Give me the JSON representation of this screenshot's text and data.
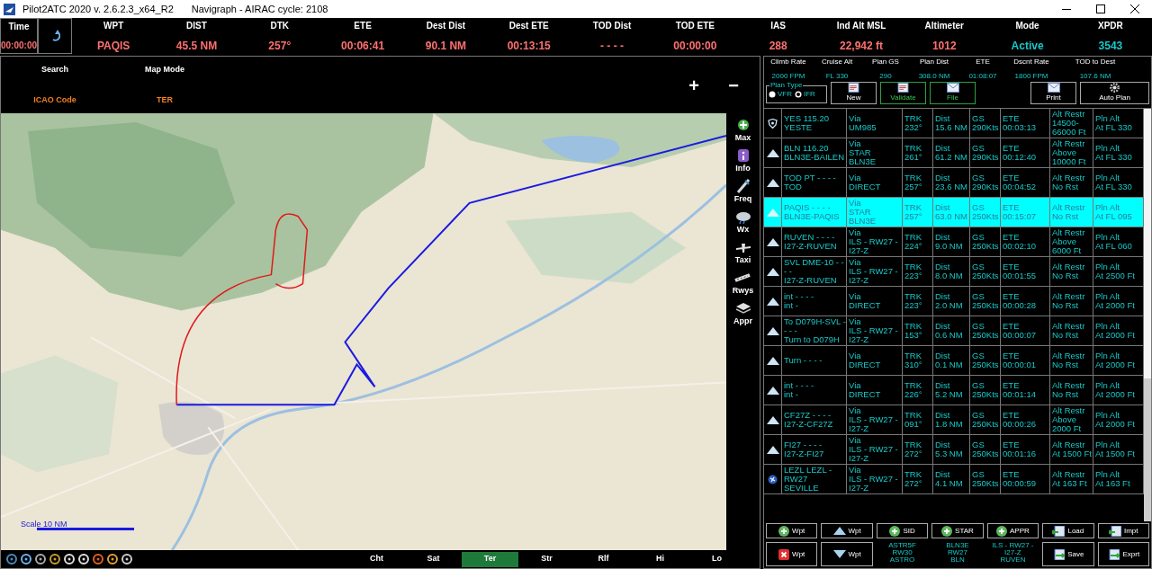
{
  "window": {
    "title": "Pilot2ATC 2020 v. 2.6.2.3_x64_R2",
    "subtitle": "Navigraph - AIRAC cycle: 2108"
  },
  "time": {
    "label": "Time",
    "value": "00:00:00"
  },
  "readouts": [
    {
      "label": "WPT",
      "value": "PAQIS",
      "color": "#ff7070"
    },
    {
      "label": "DIST",
      "value": "45.5 NM",
      "color": "#ff7070"
    },
    {
      "label": "DTK",
      "value": "257°",
      "color": "#ff7070"
    },
    {
      "label": "ETE",
      "value": "00:06:41",
      "color": "#ff7070"
    },
    {
      "label": "Dest Dist",
      "value": "90.1 NM",
      "color": "#ff7070"
    },
    {
      "label": "Dest ETE",
      "value": "00:13:15",
      "color": "#ff7070"
    },
    {
      "label": "TOD Dist",
      "value": "- - - -",
      "color": "#ff7070"
    },
    {
      "label": "TOD ETE",
      "value": "00:00:00",
      "color": "#ff7070"
    },
    {
      "label": "IAS",
      "value": "288",
      "color": "#ff7070"
    },
    {
      "label": "Ind Alt MSL",
      "value": "22,942 ft",
      "color": "#ff7070"
    },
    {
      "label": "Altimeter",
      "value": "1012",
      "color": "#ff7070"
    },
    {
      "label": "Mode",
      "value": "Active",
      "color": "#19c8c8"
    },
    {
      "label": "XPDR",
      "value": "3543",
      "color": "#19c8c8"
    }
  ],
  "map_panel": {
    "search": {
      "label": "Search",
      "value": "ICAO Code"
    },
    "map_mode": {
      "label": "Map Mode",
      "value": "TER"
    },
    "zoom_buttons": [
      "+",
      "−"
    ],
    "side_tools": [
      "Max",
      "Info",
      "Freq",
      "Wx",
      "Taxi",
      "Rwys",
      "Appr"
    ],
    "scale": "Scale 10 NM",
    "map_tabs": [
      {
        "label": "Cht",
        "selected": false
      },
      {
        "label": "Sat",
        "selected": false
      },
      {
        "label": "Ter",
        "selected": true
      },
      {
        "label": "Str",
        "selected": false
      },
      {
        "label": "Rlf",
        "selected": false
      },
      {
        "label": "Hi",
        "selected": false
      },
      {
        "label": "Lo",
        "selected": false
      }
    ]
  },
  "plan": {
    "stats": [
      {
        "label": "Climb Rate",
        "value": "2000 FPM"
      },
      {
        "label": "Cruise Alt",
        "value": "FL 330"
      },
      {
        "label": "Plan GS",
        "value": "290"
      },
      {
        "label": "Plan Dist",
        "value": "308.0 NM"
      },
      {
        "label": "ETE",
        "value": "01:08:07"
      },
      {
        "label": "Dscnt Rate",
        "value": "1800 FPM"
      },
      {
        "label": "TOD to Dest",
        "value": "107.6 NM"
      }
    ],
    "plan_type": {
      "label": "Plan Type",
      "options": [
        {
          "label": "VFR",
          "selected": false
        },
        {
          "label": "IFR",
          "selected": true
        }
      ]
    },
    "buttons_left": [
      {
        "label": "New",
        "highlighted": false
      },
      {
        "label": "Validate",
        "highlighted": true
      },
      {
        "label": "File",
        "highlighted": true
      }
    ],
    "buttons_right": [
      {
        "label": "Print",
        "highlighted": false
      },
      {
        "label": "Auto Plan",
        "highlighted": false
      }
    ]
  },
  "route_table": [
    {
      "kind": "vor",
      "selected": false,
      "name": [
        "YES   115.20",
        "YESTE"
      ],
      "via": [
        "Via",
        "UM985"
      ],
      "trk": [
        "TRK",
        "232°"
      ],
      "dist": [
        "Dist",
        "15.6 NM"
      ],
      "gs": [
        "GS",
        "290Kts"
      ],
      "ete": [
        "ETE",
        "00:03:13"
      ],
      "alt_restr": [
        "Alt Restr",
        "14500-",
        "66000 Ft"
      ],
      "pln_alt": [
        "Pln Alt",
        "At FL 330"
      ]
    },
    {
      "kind": "waypoint",
      "selected": false,
      "name": [
        "BLN   116.20",
        "BLN3E-BAILEN"
      ],
      "via": [
        "Via",
        "STAR",
        "BLN3E"
      ],
      "trk": [
        "TRK",
        "261°"
      ],
      "dist": [
        "Dist",
        "61.2 NM"
      ],
      "gs": [
        "GS",
        "290Kts"
      ],
      "ete": [
        "ETE",
        "00:12:40"
      ],
      "alt_restr": [
        "Alt Restr",
        "Above",
        "10000 Ft"
      ],
      "pln_alt": [
        "Pln Alt",
        "At FL 330"
      ]
    },
    {
      "kind": "waypoint",
      "selected": false,
      "name": [
        "TOD PT   - - - -",
        "TOD"
      ],
      "via": [
        "Via",
        "DIRECT"
      ],
      "trk": [
        "TRK",
        "257°"
      ],
      "dist": [
        "Dist",
        "23.6 NM"
      ],
      "gs": [
        "GS",
        "290Kts"
      ],
      "ete": [
        "ETE",
        "00:04:52"
      ],
      "alt_restr": [
        "Alt Restr",
        "No Rst"
      ],
      "pln_alt": [
        "Pln Alt",
        "At FL 330"
      ]
    },
    {
      "kind": "waypoint",
      "selected": true,
      "name": [
        "PAQIS   - - - -",
        "BLN3E-PAQIS"
      ],
      "via": [
        "Via",
        "STAR",
        "BLN3E"
      ],
      "trk": [
        "TRK",
        "257°"
      ],
      "dist": [
        "Dist",
        "63.0 NM"
      ],
      "gs": [
        "GS",
        "250Kts"
      ],
      "ete": [
        "ETE",
        "00:15:07"
      ],
      "alt_restr": [
        "Alt Restr",
        "No Rst"
      ],
      "pln_alt": [
        "Pln Alt",
        "At FL 095"
      ]
    },
    {
      "kind": "waypoint",
      "selected": false,
      "name": [
        "RUVEN   - - - -",
        "I27-Z-RUVEN"
      ],
      "via": [
        "Via",
        "ILS - RW27 -",
        "I27-Z"
      ],
      "trk": [
        "TRK",
        "224°"
      ],
      "dist": [
        "Dist",
        "9.0 NM"
      ],
      "gs": [
        "GS",
        "250Kts"
      ],
      "ete": [
        "ETE",
        "00:02:10"
      ],
      "alt_restr": [
        "Alt Restr",
        "Above",
        "6000 Ft"
      ],
      "pln_alt": [
        "Pln Alt",
        "At FL 060"
      ]
    },
    {
      "kind": "waypoint",
      "selected": false,
      "name": [
        "SVL DME-10   - -",
        "- -",
        "I27-Z-RUVEN"
      ],
      "via": [
        "Via",
        "ILS - RW27 -",
        "I27-Z"
      ],
      "trk": [
        "TRK",
        "223°"
      ],
      "dist": [
        "Dist",
        "8.0 NM"
      ],
      "gs": [
        "GS",
        "250Kts"
      ],
      "ete": [
        "ETE",
        "00:01:55"
      ],
      "alt_restr": [
        "Alt Restr",
        "No Rst"
      ],
      "pln_alt": [
        "Pln Alt",
        "At 2500 Ft"
      ]
    },
    {
      "kind": "waypoint",
      "selected": false,
      "name": [
        "int   - - - -",
        "int -"
      ],
      "via": [
        "Via",
        "DIRECT"
      ],
      "trk": [
        "TRK",
        "223°"
      ],
      "dist": [
        "Dist",
        "2.0 NM"
      ],
      "gs": [
        "GS",
        "250Kts"
      ],
      "ete": [
        "ETE",
        "00:00:28"
      ],
      "alt_restr": [
        "Alt Restr",
        "No Rst"
      ],
      "pln_alt": [
        "Pln Alt",
        "At 2000 Ft"
      ]
    },
    {
      "kind": "waypoint",
      "selected": false,
      "name": [
        "To D079H-SVL   -",
        "- - -",
        "Turn to D079H"
      ],
      "via": [
        "Via",
        "ILS - RW27 -",
        "I27-Z"
      ],
      "trk": [
        "TRK",
        "153°"
      ],
      "dist": [
        "Dist",
        "0.6 NM"
      ],
      "gs": [
        "GS",
        "250Kts"
      ],
      "ete": [
        "ETE",
        "00:00:07"
      ],
      "alt_restr": [
        "Alt Restr",
        "No Rst"
      ],
      "pln_alt": [
        "Pln Alt",
        "At 2000 Ft"
      ]
    },
    {
      "kind": "waypoint",
      "selected": false,
      "name": [
        "Turn   - - - -"
      ],
      "via": [
        "Via",
        "DIRECT"
      ],
      "trk": [
        "TRK",
        "310°"
      ],
      "dist": [
        "Dist",
        "0.1 NM"
      ],
      "gs": [
        "GS",
        "250Kts"
      ],
      "ete": [
        "ETE",
        "00:00:01"
      ],
      "alt_restr": [
        "Alt Restr",
        "No Rst"
      ],
      "pln_alt": [
        "Pln Alt",
        "At 2000 Ft"
      ]
    },
    {
      "kind": "waypoint",
      "selected": false,
      "name": [
        "int   - - - -",
        "int -"
      ],
      "via": [
        "Via",
        "DIRECT"
      ],
      "trk": [
        "TRK",
        "226°"
      ],
      "dist": [
        "Dist",
        "5.2 NM"
      ],
      "gs": [
        "GS",
        "250Kts"
      ],
      "ete": [
        "ETE",
        "00:01:14"
      ],
      "alt_restr": [
        "Alt Restr",
        "No Rst"
      ],
      "pln_alt": [
        "Pln Alt",
        "At 2000 Ft"
      ]
    },
    {
      "kind": "waypoint",
      "selected": false,
      "name": [
        "CF27Z   - - - -",
        "I27-Z-CF27Z"
      ],
      "via": [
        "Via",
        "ILS - RW27 -",
        "I27-Z"
      ],
      "trk": [
        "TRK",
        "091°"
      ],
      "dist": [
        "Dist",
        "1.8 NM"
      ],
      "gs": [
        "GS",
        "250Kts"
      ],
      "ete": [
        "ETE",
        "00:00:26"
      ],
      "alt_restr": [
        "Alt Restr",
        "Above",
        "2000 Ft"
      ],
      "pln_alt": [
        "Pln Alt",
        "At 2000 Ft"
      ]
    },
    {
      "kind": "waypoint",
      "selected": false,
      "name": [
        "FI27   - - - -",
        "I27-Z-FI27"
      ],
      "via": [
        "Via",
        "ILS - RW27 -",
        "I27-Z"
      ],
      "trk": [
        "TRK",
        "272°"
      ],
      "dist": [
        "Dist",
        "5.3 NM"
      ],
      "gs": [
        "GS",
        "250Kts"
      ],
      "ete": [
        "ETE",
        "00:01:16"
      ],
      "alt_restr": [
        "Alt Restr",
        "At 1500 Ft"
      ],
      "pln_alt": [
        "Pln Alt",
        "At 1500 Ft"
      ]
    },
    {
      "kind": "airport",
      "selected": false,
      "name": [
        "LEZL  LEZL -",
        "RW27",
        "SEVILLE"
      ],
      "via": [
        "Via",
        "ILS - RW27 -",
        "I27-Z"
      ],
      "trk": [
        "TRK",
        "272°"
      ],
      "dist": [
        "Dist",
        "4.1 NM"
      ],
      "gs": [
        "GS",
        "250Kts"
      ],
      "ete": [
        "ETE",
        "00:00:59"
      ],
      "alt_restr": [
        "Alt Restr",
        "At 163 Ft"
      ],
      "pln_alt": [
        "Pln Alt",
        "At 163 Ft"
      ]
    }
  ],
  "bottom_buttons": [
    {
      "kind": "add",
      "label": "Wpt"
    },
    {
      "kind": "up",
      "label": "Wpt"
    },
    {
      "kind": "add",
      "label": "SID"
    },
    {
      "kind": "add",
      "label": "STAR"
    },
    {
      "kind": "add",
      "label": "APPR"
    },
    {
      "kind": "load",
      "label": "Load"
    },
    {
      "kind": "load",
      "label": "Impt"
    },
    {
      "kind": "delete",
      "label": "Wpt"
    },
    {
      "kind": "down",
      "label": "Wpt"
    },
    {
      "kind": "info",
      "lines": [
        "ASTR5F",
        "RW30",
        "ASTRO"
      ]
    },
    {
      "kind": "info",
      "lines": [
        "BLN3E",
        "RW27",
        "BLN"
      ]
    },
    {
      "kind": "info",
      "lines": [
        "ILS - RW27 -",
        "I27-Z",
        "RUVEN"
      ]
    },
    {
      "kind": "save",
      "label": "Save"
    },
    {
      "kind": "save",
      "label": "Exprt"
    }
  ]
}
